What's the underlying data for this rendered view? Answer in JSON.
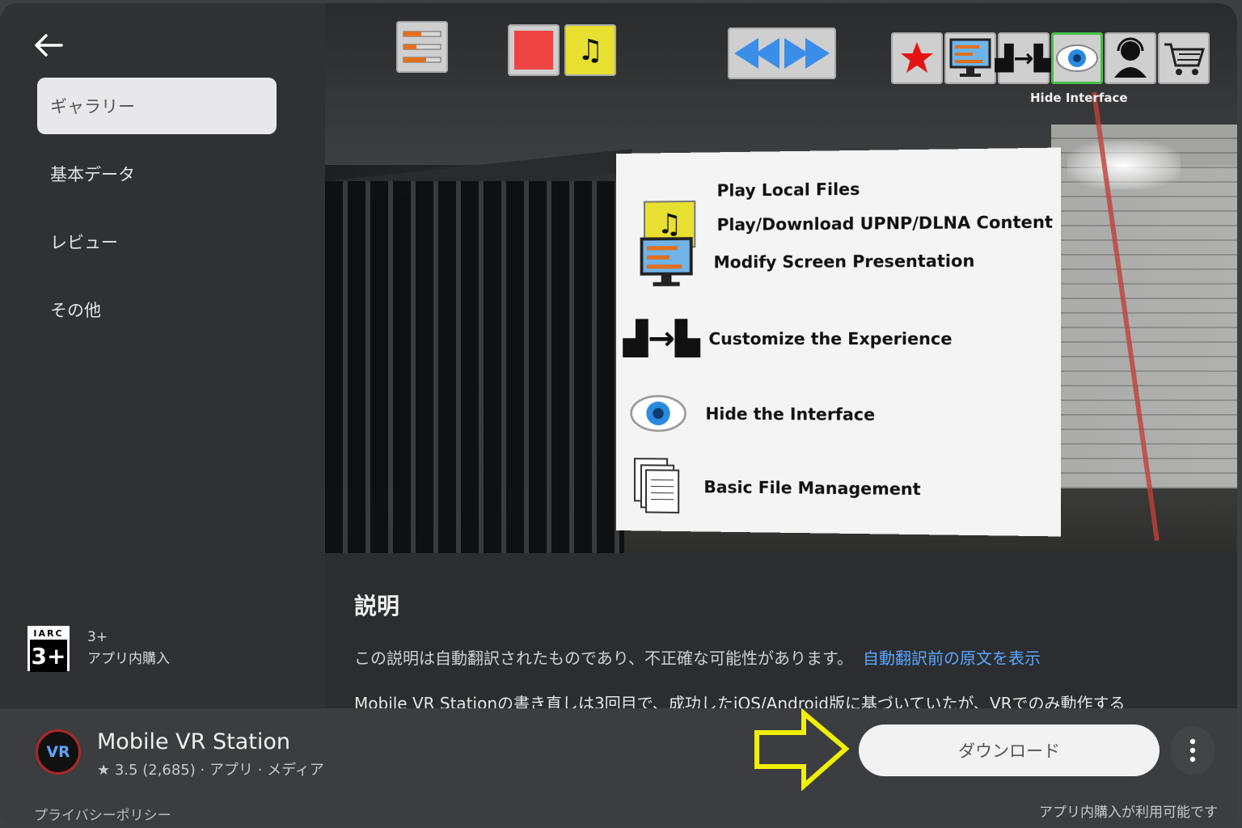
{
  "sidebar": {
    "items": [
      {
        "label": "ギャラリー",
        "active": true
      },
      {
        "label": "基本データ",
        "active": false
      },
      {
        "label": "レビュー",
        "active": false
      },
      {
        "label": "その他",
        "active": false
      }
    ]
  },
  "rating": {
    "badge_top": "IARC",
    "badge_number": "3+",
    "age": "3+",
    "iap": "アプリ内購入"
  },
  "screenshot": {
    "tooltip": "Hide Interface",
    "menu": [
      {
        "label": "Play Local Files",
        "icon": "music-note-icon"
      },
      {
        "label": "Play/Download UPNP/DLNA Content",
        "icon": "music-note-icon"
      },
      {
        "label": "Modify Screen Presentation",
        "icon": "monitor-sliders-icon"
      },
      {
        "label": "Customize the Experience",
        "icon": "swap-icon"
      },
      {
        "label": "Hide the Interface",
        "icon": "eye-icon"
      },
      {
        "label": "Basic File Management",
        "icon": "document-icon"
      }
    ]
  },
  "description": {
    "title": "説明",
    "note": "この説明は自動翻訳されたものであり、不正確な可能性があります。",
    "link": "自動翻訳前の原文を表示",
    "body": "Mobile VR Stationの書き直しは3回目で、成功したiOS/Android版に基づいていたが、VRでのみ動作する"
  },
  "app": {
    "name": "Mobile VR Station",
    "icon_text": "VR",
    "meta": "★ 3.5 (2,685) · アプリ · メディア",
    "download": "ダウンロード",
    "privacy": "プライバシーポリシー",
    "iap_note": "アプリ内購入が利用可能です"
  },
  "colors": {
    "link": "#5aa6ff",
    "arrow": "#f0f000",
    "star": "#e41414"
  }
}
